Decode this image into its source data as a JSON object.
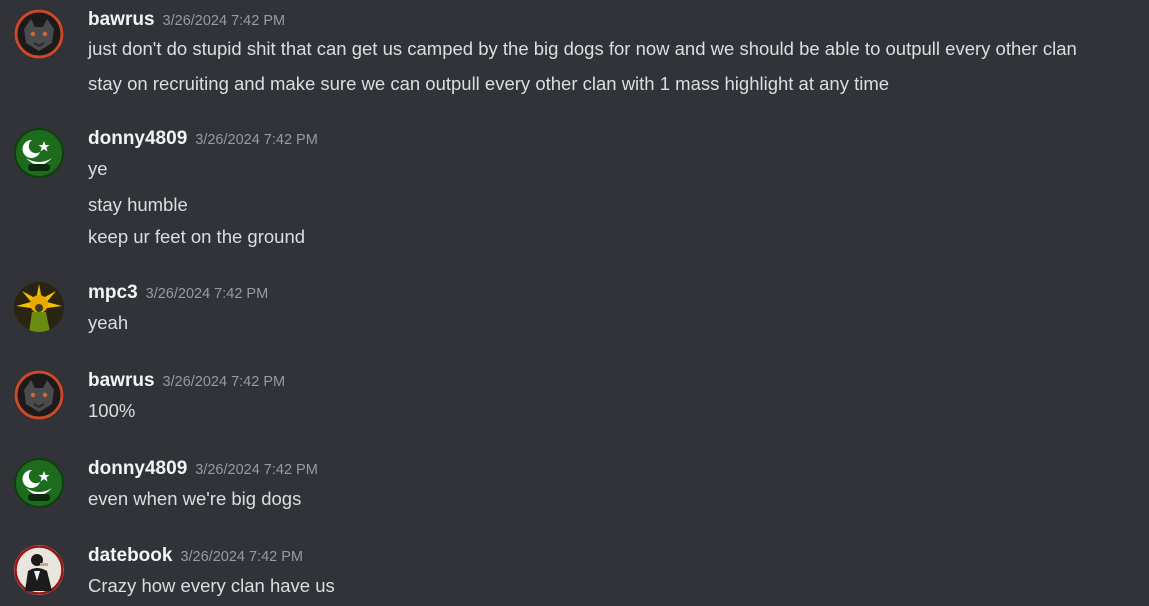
{
  "messages": [
    {
      "author": "bawrus",
      "timestamp": "3/26/2024 7:42 PM",
      "avatar_icon": "dark-dog-avatar",
      "lines": [
        "just don't do stupid shit that can get us camped by the big dogs for now and we should be able to outpull every other clan",
        "stay on recruiting and make sure we can outpull every other clan with 1 mass highlight at any time"
      ]
    },
    {
      "author": "donny4809",
      "timestamp": "3/26/2024 7:42 PM",
      "avatar_icon": "green-crescent-star-avatar",
      "lines": [
        "ye",
        "stay humble",
        "keep ur feet on the ground"
      ]
    },
    {
      "author": "mpc3",
      "timestamp": "3/26/2024 7:42 PM",
      "avatar_icon": "yellow-sunburst-avatar",
      "lines": [
        "yeah"
      ]
    },
    {
      "author": "bawrus",
      "timestamp": "3/26/2024 7:42 PM",
      "avatar_icon": "dark-dog-avatar",
      "lines": [
        "100%"
      ]
    },
    {
      "author": "donny4809",
      "timestamp": "3/26/2024 7:42 PM",
      "avatar_icon": "green-crescent-star-avatar",
      "lines": [
        "even when we're big dogs"
      ]
    },
    {
      "author": "datebook",
      "timestamp": "3/26/2024 7:42 PM",
      "avatar_icon": "suited-man-avatar",
      "lines": [
        "Crazy how every clan have us"
      ]
    }
  ],
  "colors": {
    "background": "#313338",
    "username": "#f2f3f5",
    "timestamp": "#949ba4",
    "message_text": "#dbdee1"
  }
}
